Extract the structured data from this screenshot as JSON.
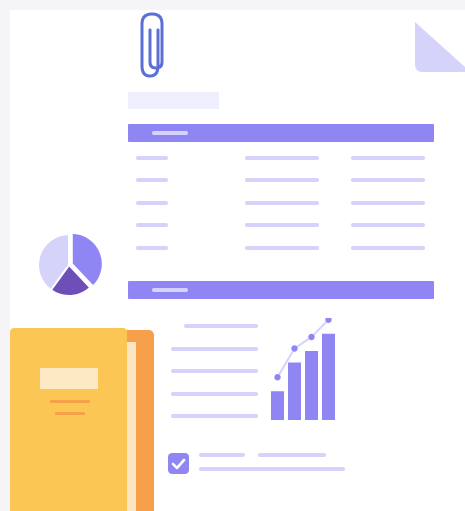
{
  "colors": {
    "purple": "#8f86f3",
    "purple_light": "#d5d3fa",
    "purple_pale": "#efeefd",
    "purple_dark": "#6e4fb8",
    "folder_yellow": "#fbc653",
    "folder_orange": "#f6a04a",
    "paperclip": "#5b6fd6"
  },
  "icons": {
    "paperclip": "paperclip-icon",
    "page_fold": "page-fold-icon",
    "pie": "pie-chart-icon",
    "folder": "folder-icon",
    "bar_chart": "bar-chart-icon",
    "checkbox": "checkbox-checked-icon"
  },
  "chart_data": [
    {
      "type": "pie",
      "values": [
        38,
        22,
        40
      ]
    },
    {
      "type": "bar",
      "values": [
        2.5,
        5,
        6,
        7.5
      ]
    }
  ],
  "checkbox": {
    "checked": true
  }
}
